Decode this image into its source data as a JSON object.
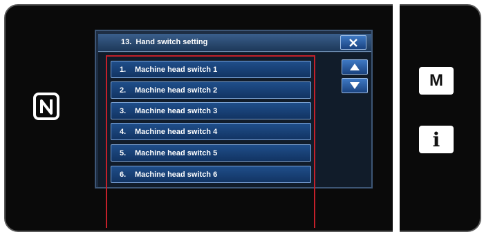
{
  "title_bar": {
    "number": "13.",
    "title": "Hand switch setting"
  },
  "icons": {
    "close": "close-icon",
    "scroll_up": "arrow-up-icon",
    "scroll_down": "arrow-down-icon",
    "nfc": "nfc-logo"
  },
  "list": [
    {
      "num": "1.",
      "label": "Machine head switch 1"
    },
    {
      "num": "2.",
      "label": "Machine head switch 2"
    },
    {
      "num": "3.",
      "label": "Machine head switch 3"
    },
    {
      "num": "4.",
      "label": "Machine head switch 4"
    },
    {
      "num": "5.",
      "label": "Machine head switch 5"
    },
    {
      "num": "6.",
      "label": "Machine head switch 6"
    }
  ],
  "side_buttons": {
    "mode": "M",
    "info": "i"
  },
  "colors": {
    "highlight": "#c4202a",
    "button_blue": "#1f4e8a",
    "screen_bg": "#1e2e44"
  }
}
